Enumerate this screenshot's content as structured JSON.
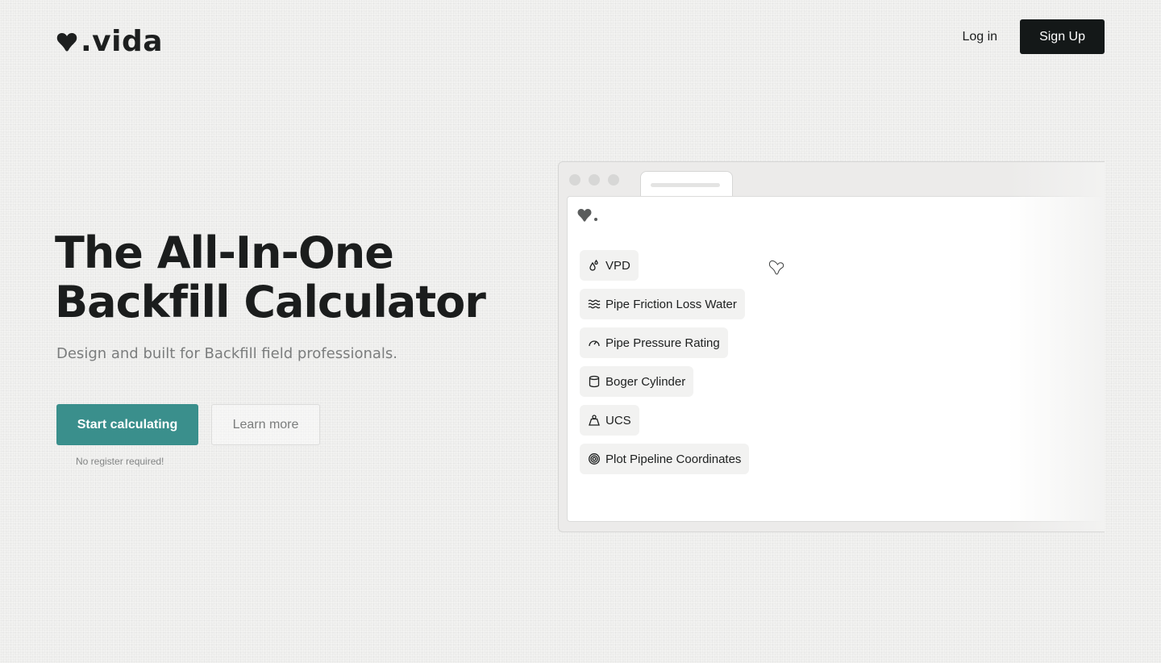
{
  "brand": {
    "name": ".vida"
  },
  "nav": {
    "login_label": "Log in",
    "signup_label": "Sign Up"
  },
  "hero": {
    "title_line1": "The All-In-One",
    "title_line2": "Backfill Calculator",
    "subtitle": "Design and built for Backfill field professionals.",
    "primary_cta": "Start calculating",
    "secondary_cta": "Learn more",
    "note": "No register required!"
  },
  "mockup": {
    "calculators": [
      {
        "label": "VPD",
        "icon": "droplets-icon"
      },
      {
        "label": "Pipe Friction Loss Water",
        "icon": "waves-icon"
      },
      {
        "label": "Pipe Pressure Rating",
        "icon": "gauge-icon"
      },
      {
        "label": "Boger Cylinder",
        "icon": "cylinder-icon"
      },
      {
        "label": "UCS",
        "icon": "weight-icon"
      },
      {
        "label": "Plot Pipeline Coordinates",
        "icon": "target-icon"
      }
    ]
  },
  "colors": {
    "primary": "#3a8f8c",
    "dark": "#141818",
    "background": "#f2f2f1"
  }
}
